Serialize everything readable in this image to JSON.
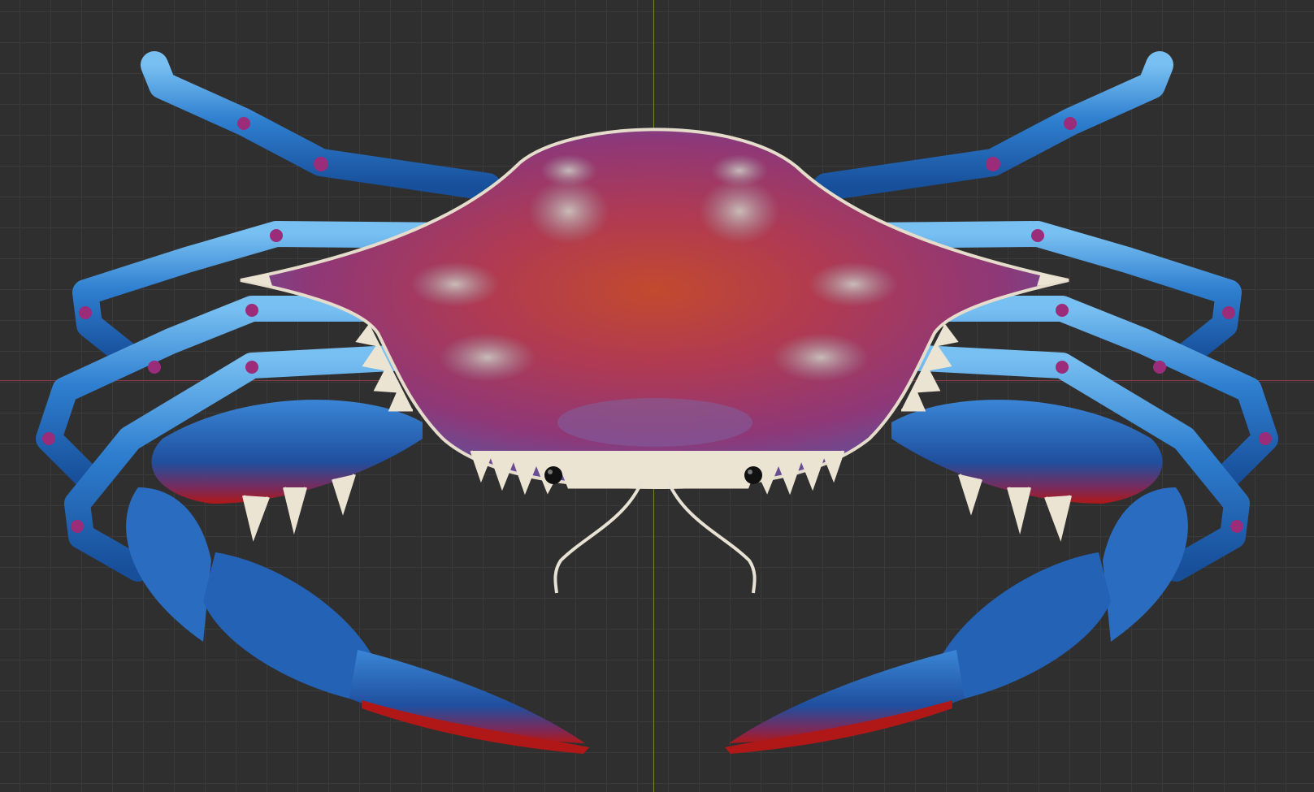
{
  "viewport": {
    "scene_object": "blue crab model",
    "background_color": "#2f2f2f",
    "grid_color": "#3a3a3a",
    "x_axis_color": "#8a3a44",
    "y_axis_color": "#6e8a2a"
  },
  "model_colors": {
    "leg_blue": "#2f7fd0",
    "leg_light": "#6fb6ee",
    "joint_purple": "#9a2c7a",
    "shell_red": "#b83a3a",
    "shell_magenta": "#a33a78",
    "shell_light": "#c9c2b4",
    "claw_tip_red": "#b01818",
    "spine_ivory": "#ece4d2"
  }
}
